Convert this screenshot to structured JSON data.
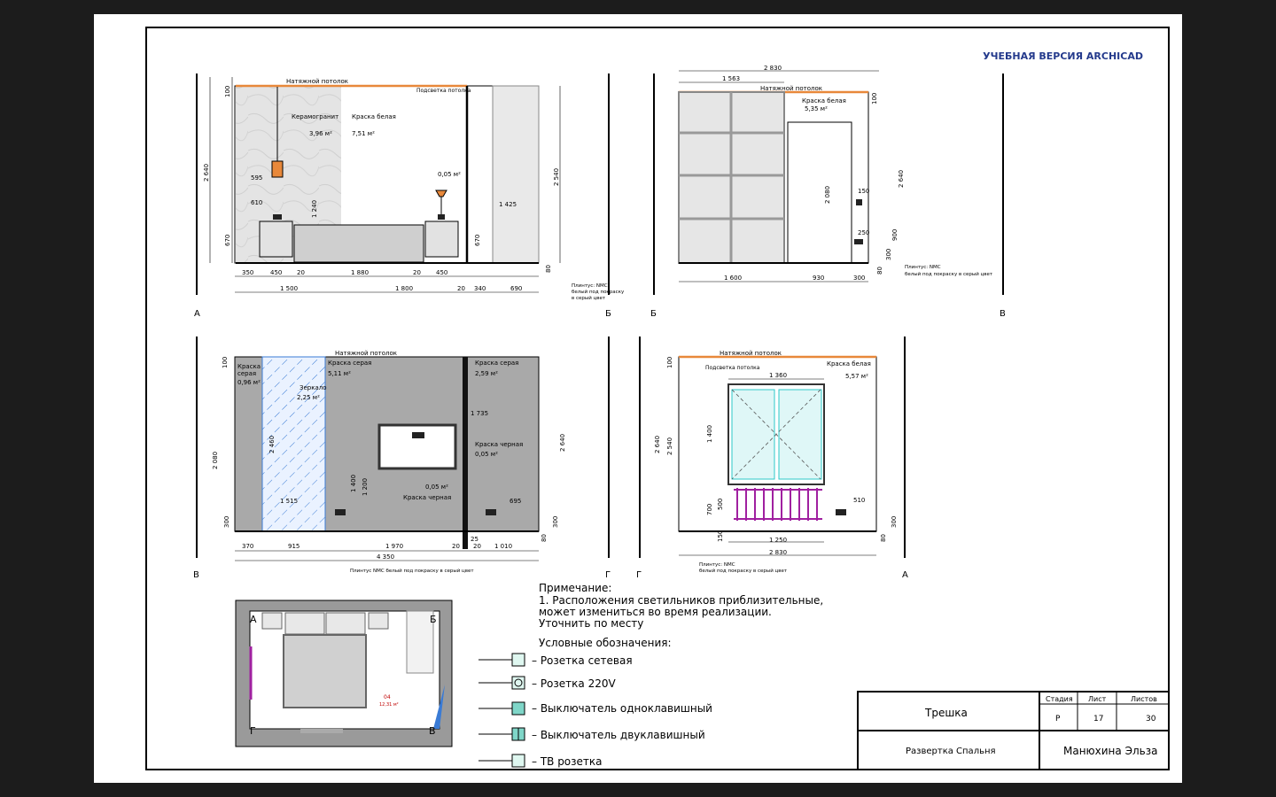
{
  "watermark": "УЧЕБНАЯ ВЕРСИЯ ARCHICAD",
  "colors": {
    "frame": "#000000",
    "wall_gray": "#a9a9a9",
    "ceiling_orange": "#e8883a",
    "window_cyan": "#2ec9c9",
    "radiator_purple": "#a020a0",
    "mirror_blue": "#3a7bd5",
    "furniture": "#d9d9d9"
  },
  "elevation_ab": {
    "left_label": "А",
    "right_label": "Б",
    "ceiling": "Натяжной потолок",
    "ceiling_light": "Подсветка потолка",
    "tile_label": "Керамогранит",
    "tile_area": "3,96 м²",
    "paint_label": "Краска белая",
    "paint_area": "7,51 м²",
    "small_area": "0,05 м²",
    "dims": {
      "d100": "100",
      "d2640": "2 640",
      "d2540": "2 540",
      "d670a": "670",
      "d670b": "670",
      "d595": "595",
      "d610": "610",
      "d1240": "1 240",
      "d1425": "1 425",
      "d80": "80",
      "b350": "350",
      "b450a": "450",
      "b20": "20",
      "b1880": "1 880",
      "b20b": "20",
      "b450b": "450",
      "b1500": "1 500",
      "b1800": "1 800",
      "b20c": "20",
      "b340": "340",
      "b690": "690"
    },
    "plinth": [
      "Плинтус: NMC",
      "белый под покраску",
      "в серый цвет"
    ]
  },
  "elevation_bv": {
    "left_label": "Б",
    "right_label": "В",
    "ceiling": "Натяжной потолок",
    "paint_label": "Краска белая",
    "paint_area": "5,35 м²",
    "dims": {
      "d2830": "2 830",
      "d1563": "1 563",
      "d100": "100",
      "d2640": "2 640",
      "d2080": "2 080",
      "d150": "150",
      "d250": "250",
      "d900": "900",
      "d300": "300",
      "d80": "80",
      "b1600": "1 600",
      "b930": "930",
      "b300": "300"
    },
    "plinth": [
      "Плинтус: NMC",
      "белый под покраску в серый цвет"
    ]
  },
  "elevation_vg": {
    "left_label": "В",
    "right_label": "Г",
    "ceiling": "Натяжной потолок",
    "gray_a": [
      "Краска",
      "серая",
      "0,96 м²"
    ],
    "mirror": "Зеркало",
    "mirror_area": "2,25 м²",
    "gray_b": "Краска серая",
    "gray_b_area": "5,11 м²",
    "gray_c": "Краска серая",
    "gray_c_area": "2,59 м²",
    "black_a": "Краска черная",
    "black_a_area": "0,05 м²",
    "black_b_area": "0,05 м²",
    "black_b": "Краска черная",
    "dims": {
      "d100": "100",
      "d2080": "2 080",
      "d2460": "2 460",
      "d1400": "1 400",
      "d1200": "1 200",
      "d1735": "1 735",
      "d1515": "1 515",
      "d695": "695",
      "d300a": "300",
      "d300b": "300",
      "d2640": "2 640",
      "d80": "80",
      "d25": "25",
      "b370": "370",
      "b915": "915",
      "b1970": "1 970",
      "b20a": "20",
      "b20b": "20",
      "b1010": "1 010",
      "b4350": "4 350"
    },
    "plinth": "Плинтус NMC белый под покраску в серый цвет"
  },
  "elevation_ga": {
    "left_label": "Г",
    "right_label": "А",
    "ceiling": "Натяжной потолок",
    "ceiling_light": "Подсветка потолка",
    "paint_label": "Краска белая",
    "paint_area": "5,57 м²",
    "dims": {
      "d100": "100",
      "d2640": "2 640",
      "d2540": "2 540",
      "d1360": "1 360",
      "d1400": "1 400",
      "d700": "700",
      "d500": "500",
      "d150": "150",
      "d510": "510",
      "d300": "300",
      "d80": "80",
      "b1250": "1 250",
      "b2830": "2 830"
    },
    "plinth": [
      "Плинтус: NMC",
      "белый под покраску в серый цвет"
    ]
  },
  "plan": {
    "A": "А",
    "B": "Б",
    "G": "Г",
    "V": "В",
    "room_no": "04",
    "room_area": "12,31 м²"
  },
  "notes": {
    "title": "Примечание:",
    "lines": [
      "1. Расположения светильников приблизительные,",
      "может измениться во время реализации.",
      "Уточнить по месту"
    ]
  },
  "legend": {
    "title": "Условные обозначения:",
    "items": [
      "– Розетка сетевая",
      "– Розетка 220V",
      "– Выключатель одноклавишный",
      "– Выключатель двуклавишный",
      "– ТВ розетка"
    ]
  },
  "title_block": {
    "project": "Трешка",
    "sheet_title": "Развертка Спальня",
    "author": "Манюхина Эльза",
    "stage_h": "Стадия",
    "sheet_h": "Лист",
    "sheets_h": "Листов",
    "stage": "Р",
    "sheet": "17",
    "sheets": "30"
  }
}
